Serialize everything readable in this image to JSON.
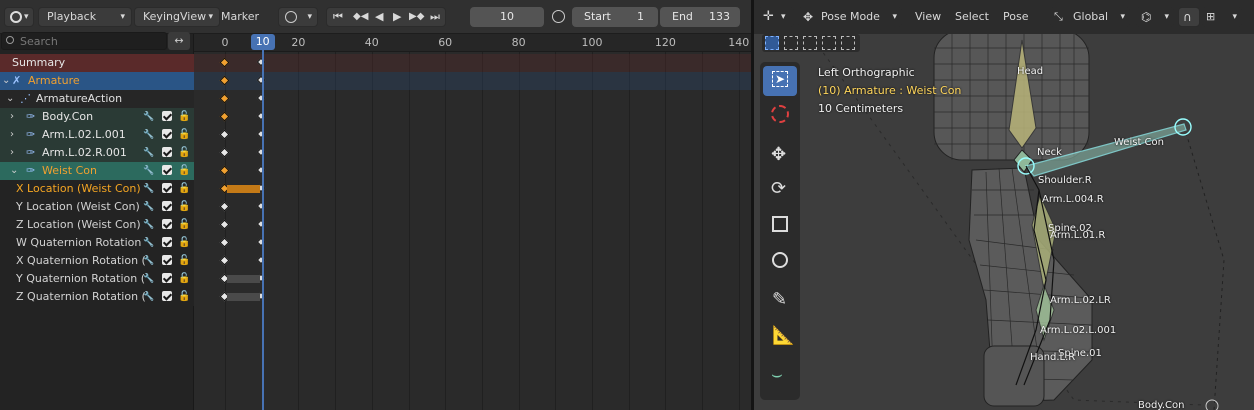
{
  "dopesheet": {
    "header": {
      "playback_label": "Playback",
      "keying_label": "Keying",
      "view_label": "View",
      "marker_label": "Marker",
      "current_frame": "10",
      "start_label": "Start",
      "start_value": "1",
      "end_label": "End",
      "end_value": "133"
    },
    "search": {
      "placeholder": "Search"
    },
    "ruler": {
      "ticks": [
        "0",
        "20",
        "40",
        "60",
        "80",
        "100",
        "120",
        "140"
      ],
      "current_frame_badge": "10"
    },
    "channels": [
      {
        "label": "Summary",
        "type": "summary"
      },
      {
        "label": "Armature",
        "type": "object"
      },
      {
        "label": "ArmatureAction",
        "type": "action"
      },
      {
        "label": "Body.Con",
        "type": "group"
      },
      {
        "label": "Arm.L.02.L.001",
        "type": "group"
      },
      {
        "label": "Arm.L.02.R.001",
        "type": "group"
      },
      {
        "label": "Weist Con",
        "type": "group-active"
      },
      {
        "label": "X Location (Weist Con)",
        "type": "fcurve-active"
      },
      {
        "label": "Y Location (Weist Con)",
        "type": "fcurve"
      },
      {
        "label": "Z Location (Weist Con)",
        "type": "fcurve"
      },
      {
        "label": "W Quaternion Rotation",
        "type": "fcurve"
      },
      {
        "label": "X Quaternion Rotation (",
        "type": "fcurve"
      },
      {
        "label": "Y Quaternion Rotation (",
        "type": "fcurve"
      },
      {
        "label": "Z Quaternion Rotation (",
        "type": "fcurve"
      }
    ]
  },
  "viewport": {
    "header": {
      "mode_label": "Pose Mode",
      "view_label": "View",
      "select_label": "Select",
      "pose_label": "Pose",
      "orientation_label": "Global"
    },
    "overlay": {
      "view_name": "Left Orthographic",
      "active_info": "(10) Armature : Weist Con",
      "scale_info": "10 Centimeters"
    },
    "bone_labels": [
      "Head",
      "Neck",
      "Weist Con",
      "Shoulder.R",
      "Arm.L.004.R",
      "Spine.02",
      "Arm.L.01.R",
      "Arm.L.02.LR",
      "Arm.L.02.L.001",
      "Spine.01",
      "Hand.L.R",
      "Body.Con"
    ],
    "tools": [
      "select-box",
      "cursor",
      "move",
      "rotate",
      "scale",
      "transform",
      "annotate",
      "measure",
      "extrude"
    ]
  },
  "colors": {
    "accent_blue": "#4772b3",
    "keyframe_selected": "#f0a030",
    "active_channel_orange": "#f5a623",
    "weist_con_group": "#2c5f55",
    "armature_row": "#2a5586",
    "summary_row": "#5a2a2a"
  }
}
